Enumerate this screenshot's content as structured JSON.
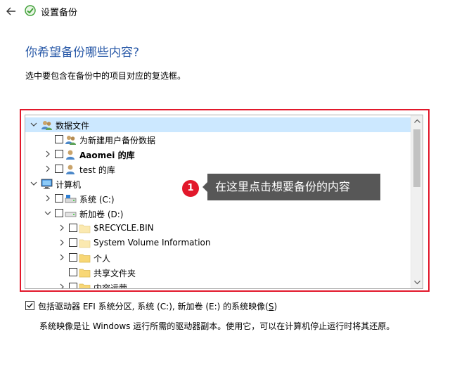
{
  "window": {
    "title": "设置备份"
  },
  "page": {
    "heading": "你希望备份哪些内容?",
    "instruction": "选中要包含在备份中的项目对应的复选框。"
  },
  "tree": {
    "items": [
      {
        "label": "数据文件",
        "level": 0,
        "expander": "down",
        "checkbox": false,
        "icon": "users-icon",
        "selected": true,
        "bold": false
      },
      {
        "label": "为新建用户备份数据",
        "level": 1,
        "expander": "none",
        "checkbox": true,
        "icon": "users-icon",
        "selected": false,
        "bold": false
      },
      {
        "label": "Aaomei 的库",
        "level": 1,
        "expander": "right",
        "checkbox": true,
        "icon": "user-icon",
        "selected": false,
        "bold": true
      },
      {
        "label": "test 的库",
        "level": 1,
        "expander": "right",
        "checkbox": true,
        "icon": "user-icon",
        "selected": false,
        "bold": false
      },
      {
        "label": "计算机",
        "level": 0,
        "expander": "down",
        "checkbox": false,
        "icon": "computer-icon",
        "selected": false,
        "bold": false
      },
      {
        "label": "系统 (C:)",
        "level": 1,
        "expander": "right",
        "checkbox": true,
        "icon": "system-drive-icon",
        "selected": false,
        "bold": false
      },
      {
        "label": "新加卷 (D:)",
        "level": 1,
        "expander": "down",
        "checkbox": true,
        "icon": "drive-icon",
        "selected": false,
        "bold": false
      },
      {
        "label": "$RECYCLE.BIN",
        "level": 2,
        "expander": "right",
        "checkbox": true,
        "icon": "folder-pale-icon",
        "selected": false,
        "bold": false
      },
      {
        "label": "System Volume Information",
        "level": 2,
        "expander": "right",
        "checkbox": true,
        "icon": "folder-pale-icon",
        "selected": false,
        "bold": false
      },
      {
        "label": "个人",
        "level": 2,
        "expander": "right",
        "checkbox": true,
        "icon": "folder-icon",
        "selected": false,
        "bold": false
      },
      {
        "label": "共享文件夹",
        "level": 2,
        "expander": "none",
        "checkbox": true,
        "icon": "folder-icon",
        "selected": false,
        "bold": false
      },
      {
        "label": "内容运营",
        "level": 2,
        "expander": "right",
        "checkbox": true,
        "icon": "folder-icon",
        "selected": false,
        "bold": false
      }
    ]
  },
  "callout": {
    "number": "1",
    "text": "在这里点击想要备份的内容"
  },
  "system_image": {
    "checked": true,
    "label": "包括驱动器 EFI 系统分区, 系统 (C:), 新加卷 (E:) 的系统映像(",
    "accesskey": "S",
    "label_end": ")",
    "description": "系统映像是让 Windows 运行所需的驱动器副本。使用它，可以在计算机停止运行时将其还原。"
  },
  "colors": {
    "heading": "#2a5aa8",
    "highlight_border": "#e2182b",
    "callout_badge": "#e2182b",
    "callout_bg": "#575757",
    "selected_row": "#cce8ff",
    "folder": "#f8d775",
    "folder_pale": "#fbe9b0"
  }
}
